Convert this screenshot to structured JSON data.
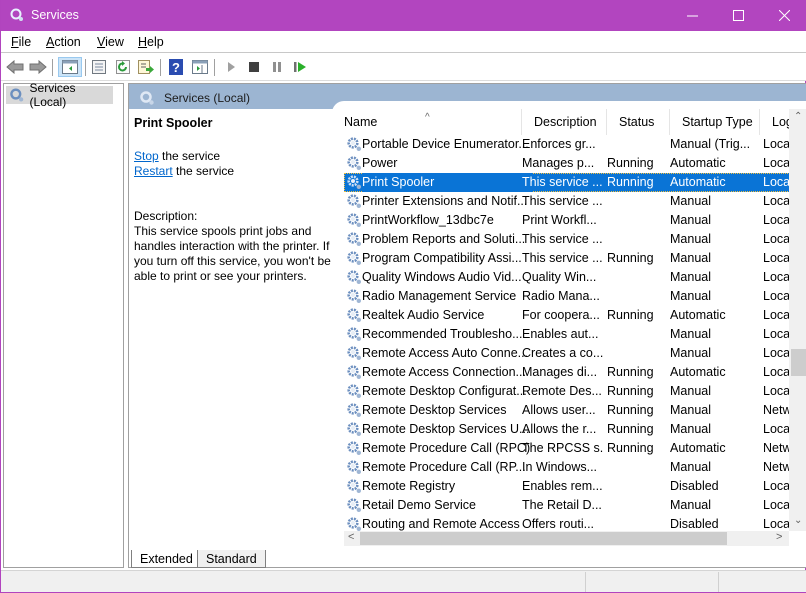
{
  "window": {
    "title": "Services",
    "minimize_glyph": "—",
    "maximize_glyph": "☐",
    "close_glyph": "✕",
    "accent_color": "#b245bf"
  },
  "menubar": {
    "items": [
      {
        "label": "File",
        "accel": "F"
      },
      {
        "label": "Action",
        "accel": "A"
      },
      {
        "label": "View",
        "accel": "V"
      },
      {
        "label": "Help",
        "accel": "H"
      }
    ]
  },
  "toolbar": {
    "buttons": [
      "back-icon",
      "forward-icon",
      "show-hide-console-tree-icon",
      "properties-icon",
      "refresh-icon",
      "export-list-icon",
      "help-icon",
      "show-hide-action-pane-icon",
      "start-service-icon",
      "stop-service-icon",
      "pause-service-icon",
      "resume-service-icon"
    ]
  },
  "tree": {
    "root_label": "Services (Local)"
  },
  "pane": {
    "header": "Services (Local)",
    "selected_service": "Print Spooler",
    "actions": [
      {
        "link": "Stop",
        "rest": " the service"
      },
      {
        "link": "Restart",
        "rest": " the service"
      }
    ],
    "description_label": "Description:",
    "description": "This service spools print jobs and handles interaction with the printer. If you turn off this service, you won't be able to print or see your printers."
  },
  "list": {
    "columns": [
      "Name",
      "Description",
      "Status",
      "Startup Type",
      "Log"
    ],
    "sort_indicator": "^",
    "rows": [
      {
        "name": "Portable Device Enumerator...",
        "desc": "Enforces gr...",
        "status": "",
        "startup": "Manual (Trig...",
        "logon": "Loca"
      },
      {
        "name": "Power",
        "desc": "Manages p...",
        "status": "Running",
        "startup": "Automatic",
        "logon": "Loca"
      },
      {
        "name": "Print Spooler",
        "desc": "This service ...",
        "status": "Running",
        "startup": "Automatic",
        "logon": "Loca",
        "selected": true
      },
      {
        "name": "Printer Extensions and Notif...",
        "desc": "This service ...",
        "status": "",
        "startup": "Manual",
        "logon": "Loca"
      },
      {
        "name": "PrintWorkflow_13dbc7e",
        "desc": "Print Workfl...",
        "status": "",
        "startup": "Manual",
        "logon": "Loca"
      },
      {
        "name": "Problem Reports and Soluti...",
        "desc": "This service ...",
        "status": "",
        "startup": "Manual",
        "logon": "Loca"
      },
      {
        "name": "Program Compatibility Assi...",
        "desc": "This service ...",
        "status": "Running",
        "startup": "Manual",
        "logon": "Loca"
      },
      {
        "name": "Quality Windows Audio Vid...",
        "desc": "Quality Win...",
        "status": "",
        "startup": "Manual",
        "logon": "Loca"
      },
      {
        "name": "Radio Management Service",
        "desc": "Radio Mana...",
        "status": "",
        "startup": "Manual",
        "logon": "Loca"
      },
      {
        "name": "Realtek Audio Service",
        "desc": "For coopera...",
        "status": "Running",
        "startup": "Automatic",
        "logon": "Loca"
      },
      {
        "name": "Recommended Troublesho...",
        "desc": "Enables aut...",
        "status": "",
        "startup": "Manual",
        "logon": "Loca"
      },
      {
        "name": "Remote Access Auto Conne...",
        "desc": "Creates a co...",
        "status": "",
        "startup": "Manual",
        "logon": "Loca"
      },
      {
        "name": "Remote Access Connection...",
        "desc": "Manages di...",
        "status": "Running",
        "startup": "Automatic",
        "logon": "Loca"
      },
      {
        "name": "Remote Desktop Configurat...",
        "desc": "Remote Des...",
        "status": "Running",
        "startup": "Manual",
        "logon": "Loca"
      },
      {
        "name": "Remote Desktop Services",
        "desc": "Allows user...",
        "status": "Running",
        "startup": "Manual",
        "logon": "Netw"
      },
      {
        "name": "Remote Desktop Services U...",
        "desc": "Allows the r...",
        "status": "Running",
        "startup": "Manual",
        "logon": "Loca"
      },
      {
        "name": "Remote Procedure Call (RPC)",
        "desc": "The RPCSS s...",
        "status": "Running",
        "startup": "Automatic",
        "logon": "Netw"
      },
      {
        "name": "Remote Procedure Call (RP...",
        "desc": "In Windows...",
        "status": "",
        "startup": "Manual",
        "logon": "Netw"
      },
      {
        "name": "Remote Registry",
        "desc": "Enables rem...",
        "status": "",
        "startup": "Disabled",
        "logon": "Loca"
      },
      {
        "name": "Retail Demo Service",
        "desc": "The Retail D...",
        "status": "",
        "startup": "Manual",
        "logon": "Loca"
      },
      {
        "name": "Routing and Remote Access",
        "desc": "Offers routi...",
        "status": "",
        "startup": "Disabled",
        "logon": "Loca"
      }
    ],
    "selected_color": "#0a74d6",
    "scroll_up": "^",
    "scroll_down": "v",
    "scroll_left": "<",
    "scroll_right": ">"
  },
  "tabs": [
    {
      "label": "Extended",
      "active": true
    },
    {
      "label": "Standard",
      "active": false
    }
  ]
}
